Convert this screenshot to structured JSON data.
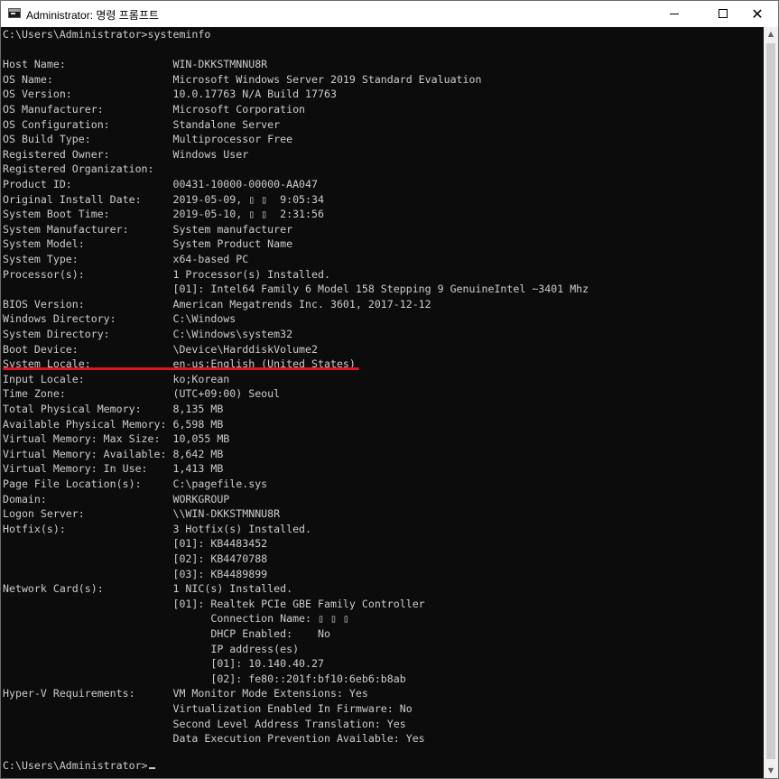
{
  "window": {
    "title": "Administrator: 명령 프롬프트",
    "min_symbol": "—",
    "max_symbol": "□",
    "close_symbol": "✕"
  },
  "console": {
    "command_line": "C:\\Users\\Administrator>systeminfo",
    "blank": "",
    "lines": [
      "Host Name:                 WIN-DKKSTMNNU8R",
      "OS Name:                   Microsoft Windows Server 2019 Standard Evaluation",
      "OS Version:                10.0.17763 N/A Build 17763",
      "OS Manufacturer:           Microsoft Corporation",
      "OS Configuration:          Standalone Server",
      "OS Build Type:             Multiprocessor Free",
      "Registered Owner:          Windows User",
      "Registered Organization:",
      "Product ID:                00431-10000-00000-AA047",
      "Original Install Date:     2019-05-09, ▯ ▯  9:05:34",
      "System Boot Time:          2019-05-10, ▯ ▯  2:31:56",
      "System Manufacturer:       System manufacturer",
      "System Model:              System Product Name",
      "System Type:               x64-based PC",
      "Processor(s):              1 Processor(s) Installed.",
      "                           [01]: Intel64 Family 6 Model 158 Stepping 9 GenuineIntel ~3401 Mhz",
      "BIOS Version:              American Megatrends Inc. 3601, 2017-12-12",
      "Windows Directory:         C:\\Windows",
      "System Directory:          C:\\Windows\\system32",
      "Boot Device:               \\Device\\HarddiskVolume2",
      "System Locale:             en-us;English (United States)",
      "Input Locale:              ko;Korean",
      "Time Zone:                 (UTC+09:00) Seoul",
      "Total Physical Memory:     8,135 MB",
      "Available Physical Memory: 6,598 MB",
      "Virtual Memory: Max Size:  10,055 MB",
      "Virtual Memory: Available: 8,642 MB",
      "Virtual Memory: In Use:    1,413 MB",
      "Page File Location(s):     C:\\pagefile.sys",
      "Domain:                    WORKGROUP",
      "Logon Server:              \\\\WIN-DKKSTMNNU8R",
      "Hotfix(s):                 3 Hotfix(s) Installed.",
      "                           [01]: KB4483452",
      "                           [02]: KB4470788",
      "                           [03]: KB4489899",
      "Network Card(s):           1 NIC(s) Installed.",
      "                           [01]: Realtek PCIe GBE Family Controller",
      "                                 Connection Name: ▯ ▯ ▯",
      "                                 DHCP Enabled:    No",
      "                                 IP address(es)",
      "                                 [01]: 10.140.40.27",
      "                                 [02]: fe80::201f:bf10:6eb6:b8ab",
      "Hyper-V Requirements:      VM Monitor Mode Extensions: Yes",
      "                           Virtualization Enabled In Firmware: No",
      "                           Second Level Address Translation: Yes",
      "                           Data Execution Prevention Available: Yes"
    ],
    "prompt": "C:\\Users\\Administrator>"
  },
  "scrollbar": {
    "up_arrow": "▲",
    "down_arrow": "▼"
  },
  "colors": {
    "console_bg": "#0c0c0c",
    "console_text": "#cccccc",
    "highlight_underline": "#e0141e"
  }
}
